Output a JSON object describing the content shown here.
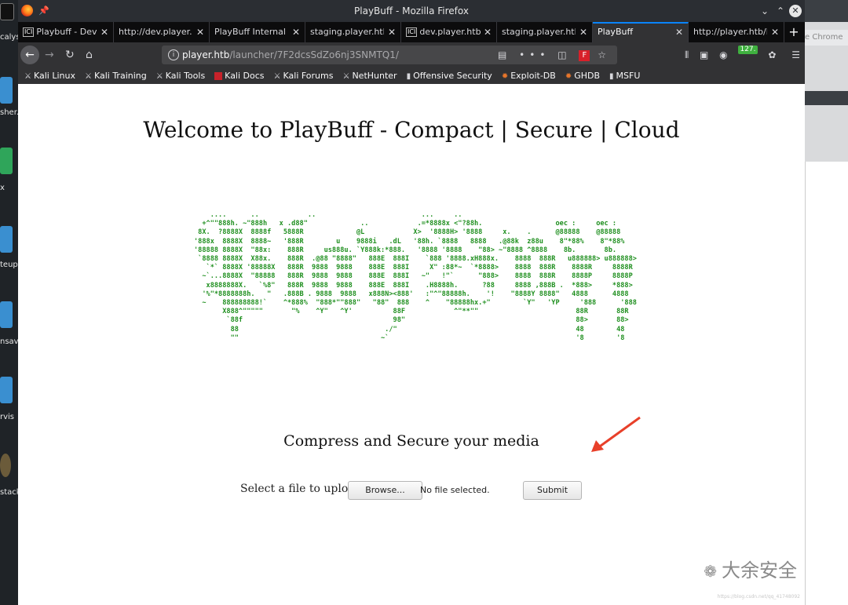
{
  "window": {
    "title": "PlayBuff - Mozilla Firefox"
  },
  "desktop": {
    "labels": [
      "calys",
      "sher.",
      "x",
      "teup",
      "nsav",
      "rvis",
      "stack"
    ],
    "right_tab_text": "e Chrome"
  },
  "tabs": [
    {
      "label": "Playbuff - Dev",
      "favicon": "ICI",
      "active": false
    },
    {
      "label": "http://dev.player.h",
      "favicon": "",
      "active": false
    },
    {
      "label": "PlayBuff Internal U",
      "favicon": "",
      "active": false
    },
    {
      "label": "staging.player.htb/",
      "favicon": "",
      "active": false
    },
    {
      "label": "dev.player.htb",
      "favicon": "ICI",
      "active": false
    },
    {
      "label": "staging.player.htb",
      "favicon": "",
      "active": false
    },
    {
      "label": "PlayBuff",
      "favicon": "",
      "active": true
    },
    {
      "label": "http://player.htb/l",
      "favicon": "",
      "active": false
    }
  ],
  "nav": {
    "url_host": "player.htb",
    "url_path": "/launcher/7F2dcsSdZo6nj3SNMTQ1/",
    "dots": "•••",
    "ext_letter": "F",
    "badge": "127."
  },
  "bookmarks": [
    {
      "label": "Kali Linux",
      "icon": "kali-icon"
    },
    {
      "label": "Kali Training",
      "icon": "kali-icon"
    },
    {
      "label": "Kali Tools",
      "icon": "kali-icon"
    },
    {
      "label": "Kali Docs",
      "icon": "kali-docs-icon"
    },
    {
      "label": "Kali Forums",
      "icon": "kali-icon"
    },
    {
      "label": "NetHunter",
      "icon": "kali-icon"
    },
    {
      "label": "Offensive Security",
      "icon": "offsec-icon"
    },
    {
      "label": "Exploit-DB",
      "icon": "exploitdb-icon"
    },
    {
      "label": "GHDB",
      "icon": "exploitdb-icon"
    },
    {
      "label": "MSFU",
      "icon": "offsec-icon"
    }
  ],
  "page": {
    "heading": "Welcome to PlayBuff - Compact | Secure | Cloud",
    "ascii_art": "    ....      ..            ..                          ...     ..                                                    \n  +^\"\"888h. ~\"888h   x .d88\"             ..            .=*8888x <\"?88h.                  oec :     oec :  \n 8X.  ?8888X  8888f   5888R             @L            X>  '8888H> '8888     x.    .      @88888    @88888  \n'888x  8888X  8888~   '888R        u    9888i   .dL   '88h. `8888   8888   .@88k  z88u    8\"*88%    8\"*88%  \n'88888 8888X  \"88x:    888R     us888u. `Y888k:*888.   '8888 '8888    \"88> ~\"8888 ^8888    8b.       8b.     \n `8888 8888X  X88x.    888R  .@88 \"8888\"   888E  888I    `888 '8888.xH888x.    8888  888R   u888888> u888888> \n   `*` 8888X '88888X   888R  9888  9888    888E  888I     X\" :88*~  `*8888>    8888  888R    8888R     8888R   \n  ~`...8888X  \"88888   888R  9888  9888    888E  888I   ~\"   !\"`      \"888>    8888  888R    8888P     8888P   \n   x8888888X.   `%8\"   888R  9888  9888    888E  888I    .H8888h.      ?88     8888 ,888B .  *888>     *888>   \n  '%\"*8888888h.   \"   .888B . 9888  9888   x888N><888'   :\"^\"88888h.    '!    \"8888Y 8888\"   4888      4888    \n  ~    888888888!`    ^*888%  \"888*\"\"888\"   \"88\"  888    ^    \"88888hx.+\"        `Y\"   'YP     '888      '888    \n       X888^\"\"\"\"\"       \"%    ^Y\"   ^Y'          88F            ^\"**\"\"                        88R       88R     \n        `88f                                     98\"                                          88>       88>     \n         88                                    ./\"                                            48        48      \n         \"\"                                   ~`                                              '8        '8      ",
    "subtitle": "Compress and Secure your media",
    "upload_label": "Select a file to upload",
    "browse_label": "Browse...",
    "file_status": "No file selected.",
    "submit_label": "Submit"
  },
  "watermark": {
    "text": "大余安全",
    "url": "https://blog.csdn.net/qq_41748092"
  }
}
